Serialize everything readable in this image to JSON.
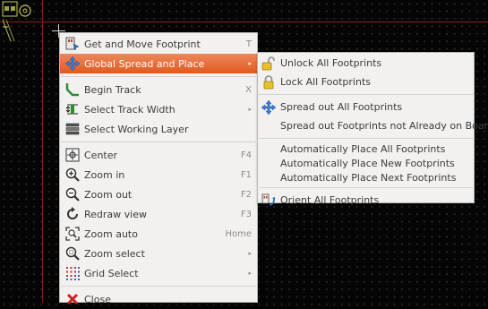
{
  "colors": {
    "canvas_background": "#050505",
    "board_edge": "#8a1b1b",
    "menu_background": "#f2f1f0",
    "highlight_start": "#f0865a",
    "highlight_end": "#e05a20",
    "shortcut_text": "#8d8d8d"
  },
  "context_menu": {
    "items": [
      {
        "label": "Get and Move Footprint",
        "shortcut": "T",
        "icon": "move-footprint-icon"
      },
      {
        "label": "Global Spread and Place",
        "submenu_arrow": "▸",
        "icon": "spread-place-icon",
        "highlighted": true
      },
      {
        "label": "Begin Track",
        "shortcut": "X",
        "icon": "track-icon"
      },
      {
        "label": "Select Track Width",
        "submenu_arrow": "▸",
        "icon": "track-width-icon"
      },
      {
        "label": "Select Working Layer",
        "icon": "layer-stack-icon"
      },
      {
        "label": "Center",
        "shortcut": "F4",
        "icon": "center-icon"
      },
      {
        "label": "Zoom in",
        "shortcut": "F1",
        "icon": "zoom-in-icon"
      },
      {
        "label": "Zoom out",
        "shortcut": "F2",
        "icon": "zoom-out-icon"
      },
      {
        "label": "Redraw view",
        "shortcut": "F3",
        "icon": "redraw-icon"
      },
      {
        "label": "Zoom auto",
        "shortcut": "Home",
        "icon": "zoom-auto-icon"
      },
      {
        "label": "Zoom select",
        "submenu_arrow": "▸",
        "icon": "zoom-select-icon"
      },
      {
        "label": "Grid Select",
        "submenu_arrow": "▸",
        "icon": "grid-icon"
      },
      {
        "label": "Close",
        "icon": "close-icon"
      }
    ]
  },
  "submenu": {
    "items": [
      {
        "label": "Unlock All Footprints",
        "icon": "unlock-icon"
      },
      {
        "label": "Lock All Footprints",
        "icon": "lock-icon"
      },
      {
        "label": "Spread out All Footprints",
        "icon": "spread-icon"
      },
      {
        "label": "Spread out Footprints not Already on Board"
      },
      {
        "label": "Automatically Place All Footprints"
      },
      {
        "label": "Automatically Place New Footprints"
      },
      {
        "label": "Automatically Place Next Footprints"
      },
      {
        "label": "Orient All Footprints",
        "icon": "orient-icon"
      }
    ]
  }
}
